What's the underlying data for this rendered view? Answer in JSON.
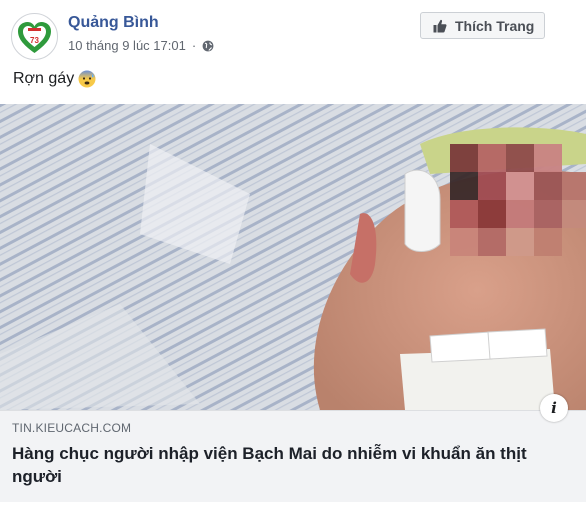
{
  "post": {
    "page_name": "Quảng Bình",
    "timestamp": "10 tháng 9 lúc 17:01",
    "separator": "·",
    "audience_icon": "globe-icon",
    "like_page_label": "Thích Trang",
    "like_icon": "thumbs-up-icon",
    "text": "Rợn gáy",
    "emoji": "anxious-face-with-sweat-emoji",
    "avatar_label": "73"
  },
  "link_preview": {
    "domain": "TIN.KIEUCACH.COM",
    "title": "Hàng chục người nhập viện Bạch Mai do nhiễm vi khuẩn ăn thịt người",
    "info_icon": "info-icon",
    "info_label": "i"
  },
  "colors": {
    "brand_link": "#385898",
    "logo_green": "#2f9a3c",
    "logo_red": "#d32f2f"
  }
}
